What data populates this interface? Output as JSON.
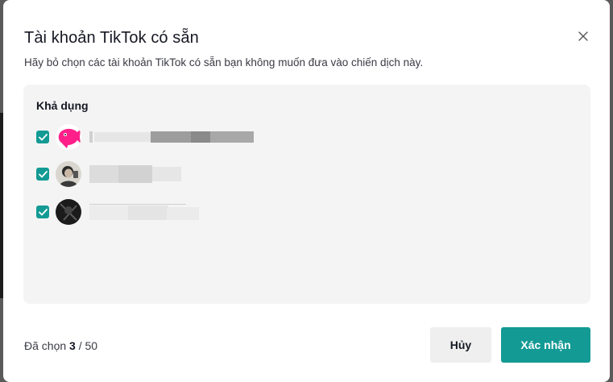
{
  "modal": {
    "title": "Tài khoản TikTok có sẵn",
    "subtitle": "Hãy bỏ chọn các tài khoản TikTok có sẵn bạn không muốn đưa vào chiến dịch này.",
    "close_icon": "close-icon"
  },
  "panel": {
    "section_label": "Khả dụng",
    "accounts": [
      {
        "checked": true,
        "avatar_icon": "pink-fish-avatar",
        "name_redacted": true
      },
      {
        "checked": true,
        "avatar_icon": "person-photo-avatar",
        "name_redacted": true
      },
      {
        "checked": true,
        "avatar_icon": "dark-photo-avatar",
        "name_redacted": true
      }
    ]
  },
  "footer": {
    "selected_prefix": "Đã chọn",
    "selected_count": "3",
    "selected_separator": "/",
    "selected_total": "50",
    "cancel_label": "Hủy",
    "confirm_label": "Xác nhận"
  },
  "colors": {
    "accent": "#139a94",
    "panel_bg": "#f4f4f4",
    "cancel_bg": "#efefef"
  }
}
